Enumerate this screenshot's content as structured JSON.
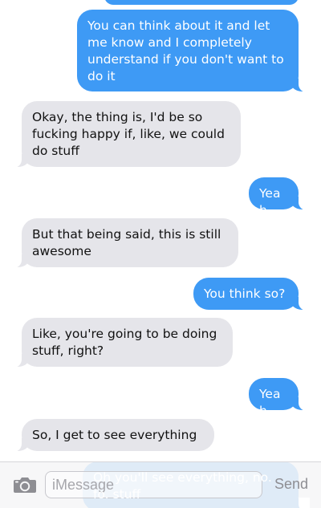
{
  "thread": {
    "messages": [
      {
        "from": "me",
        "text": "You can think about it and let me know and I completely understand if you don't want to do it"
      },
      {
        "from": "them",
        "text": "Okay, the thing is, I'd be so fucking happy if, like, we could do stuff"
      },
      {
        "from": "me",
        "text": "Yeah"
      },
      {
        "from": "them",
        "text": "But that being said, this is still awesome"
      },
      {
        "from": "me",
        "text": "You think so?"
      },
      {
        "from": "them",
        "text": "Like, you're going to be doing stuff, right?"
      },
      {
        "from": "me",
        "text": "Yeah"
      },
      {
        "from": "them",
        "text": "So, I get to see everything"
      },
      {
        "from": "me",
        "text": "Oh you'll see everything, no. fo. stuff"
      }
    ]
  },
  "composer": {
    "camera_icon": "camera-icon",
    "placeholder": "iMessage",
    "send_label": "Send"
  },
  "colors": {
    "outgoing": "#3e9af5",
    "incoming": "#e5e5ea",
    "send": "#8e8e93"
  }
}
